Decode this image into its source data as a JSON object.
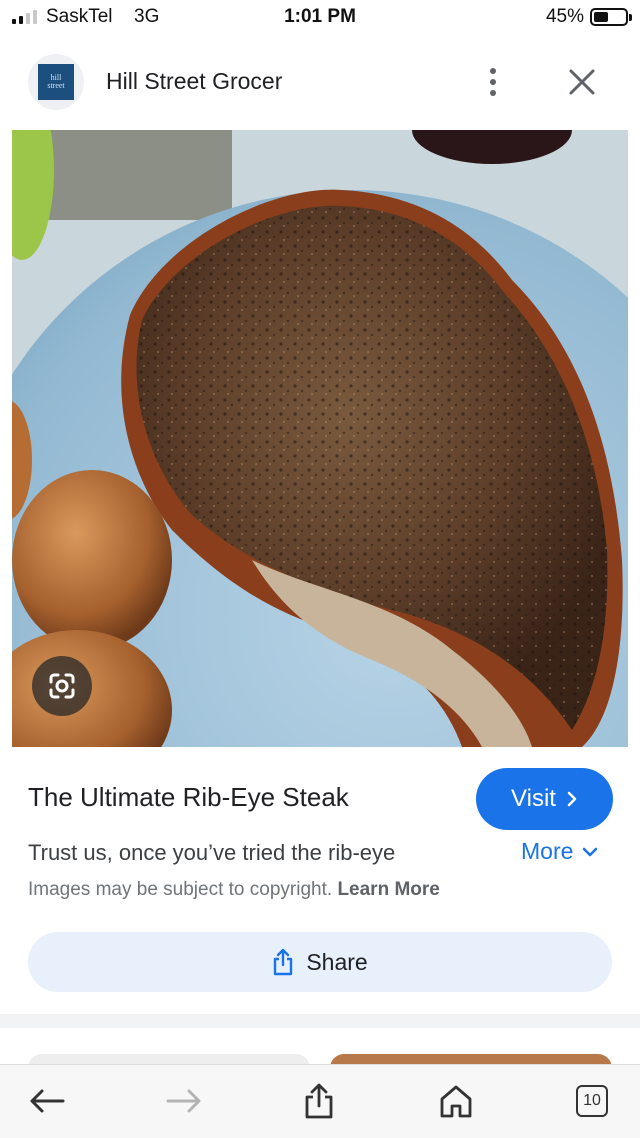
{
  "status_bar": {
    "carrier": "SaskTel",
    "network": "3G",
    "time": "1:01 PM",
    "battery_percent": "45%",
    "battery_level": 0.45
  },
  "header": {
    "logo_text_line1": "hill",
    "logo_text_line2": "street",
    "site_name": "Hill Street Grocer"
  },
  "result": {
    "title": "The Ultimate Rib-Eye Steak",
    "visit_label": "Visit",
    "description": "Trust us, once you’ve tried the rib-eye",
    "more_label": "More",
    "copyright_text": "Images may be subject to copyright.",
    "learn_more_label": "Learn More",
    "share_label": "Share"
  },
  "toolbar": {
    "tab_count": "10"
  },
  "icons": {
    "back": "back-arrow-icon",
    "forward": "forward-arrow-icon",
    "share": "share-icon",
    "home": "home-icon",
    "tabs": "tabs-icon",
    "close": "close-icon",
    "menu": "more-vert-icon",
    "lens": "google-lens-icon"
  },
  "colors": {
    "accent": "#1a73e8",
    "share_button_bg": "#e8f0fb",
    "toolbar_bg": "#f7f7f7"
  }
}
